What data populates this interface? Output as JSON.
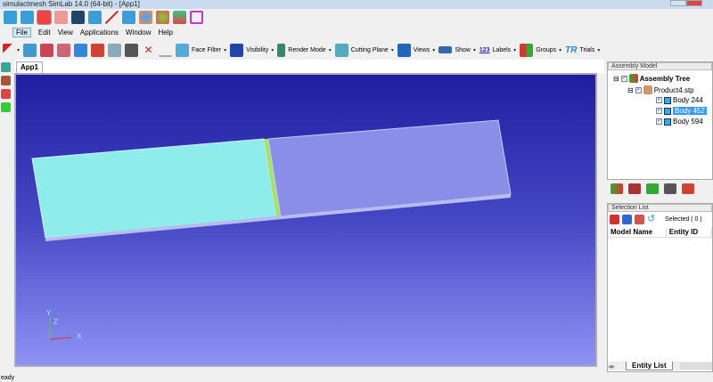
{
  "window": {
    "title": "simulactmesh SimLab 14.0 (64-bit) - [App1]"
  },
  "menu": [
    "File",
    "Edit",
    "View",
    "Applications",
    "Window",
    "Help"
  ],
  "toolbar": {
    "face_filter": "Face Filter",
    "visibility": "Visibility",
    "render_mode": "Render Mode",
    "cutting_plane": "Cutting Plane",
    "views": "Views",
    "show": "Show",
    "labels": "Labels",
    "labels_icon_text": "123",
    "groups": "Groups",
    "trials": "Trials",
    "trials_icon_text": "TR"
  },
  "document_tab": "App1",
  "axis": {
    "x": "X",
    "y": "Y",
    "z": "Z"
  },
  "assembly": {
    "header": "Assembly Model",
    "root": "Assembly Tree",
    "product": "Product4.stp",
    "bodies": [
      "Body 244",
      "Body 452",
      "Body 594"
    ],
    "selected_body": "Body 452"
  },
  "selection": {
    "header": "Selection List",
    "count": "Selected ( 0 )",
    "columns": [
      "Model Name",
      "Entity ID"
    ],
    "tab": "Entity List"
  },
  "status": "eady",
  "colors": {
    "part_left": "#8eecea",
    "part_right": "#8b8ee6",
    "seam": "#a6e26a"
  }
}
